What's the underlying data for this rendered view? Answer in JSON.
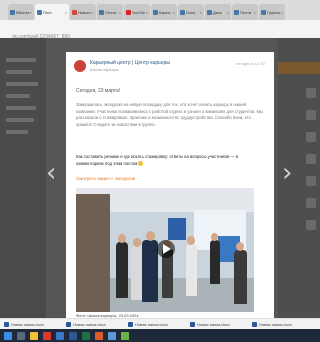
{
  "browser": {
    "tabs": [
      {
        "label": "ВКонтакте",
        "color": "#4a76a8",
        "active": false
      },
      {
        "label": "Пост",
        "color": "#4a76a8",
        "active": true
      },
      {
        "label": "Новости",
        "color": "#d64541",
        "active": false
      },
      {
        "label": "Почта",
        "color": "#4a76a8",
        "active": false
      },
      {
        "label": "YouTube",
        "color": "#e02020",
        "active": false
      },
      {
        "label": "Карты",
        "color": "#4a76a8",
        "active": false
      },
      {
        "label": "Docs",
        "color": "#4a76a8",
        "active": false
      },
      {
        "label": "Диск",
        "color": "#4a76a8",
        "active": false
      },
      {
        "label": "Почта",
        "color": "#4a76a8",
        "active": false
      },
      {
        "label": "Группа",
        "color": "#4a76a8",
        "active": false
      }
    ],
    "url": "vk.com/wall-1234567_890"
  },
  "post": {
    "author": "Карьерный центр | Центр карьеры",
    "subtitle": "Школа карьеры",
    "date": "сегодня в 12:30",
    "greeting": "Сегодня, 23 марта!",
    "paragraph": "Завершилась экскурсия на новую площадку для тех, кто хочет начать карьеру в нашей компании. Участники познакомились с работой отдела и узнали о вакансиях для студентов. Мы рассказали о стажировках, практике и возможностях трудоустройства. Спасибо всем, кто пришёл! Следите за новостями в группе.",
    "emphasis": "Как составить резюме и где искать стажировку: ответы на вопросы участников — в комментариях под этим постом",
    "orange_link": "Смотреть видео с экскурсии",
    "caption": "Фото: Школа карьеры, 23.03.2024"
  },
  "nav": {
    "prev": "‹",
    "next": "›"
  },
  "downloads": [
    {
      "label": "Новая папка.docx",
      "color": "#2b5797"
    },
    {
      "label": "Новая папка.docx",
      "color": "#2b5797"
    },
    {
      "label": "Новая папка.docx",
      "color": "#2b5797"
    },
    {
      "label": "Новая папка.docx",
      "color": "#2b5797"
    },
    {
      "label": "Новая папка.docx",
      "color": "#2b5797"
    }
  ],
  "taskbar": [
    {
      "name": "start-icon",
      "color": "#3a8ee6"
    },
    {
      "name": "search-icon",
      "color": "#5a6a7a"
    },
    {
      "name": "explorer-icon",
      "color": "#f2c230"
    },
    {
      "name": "browser-icon",
      "color": "#d93a2e"
    },
    {
      "name": "mail-icon",
      "color": "#3b78c6"
    },
    {
      "name": "word-icon",
      "color": "#2b5797"
    },
    {
      "name": "excel-icon",
      "color": "#1e7145"
    },
    {
      "name": "media-icon",
      "color": "#e05a2a"
    },
    {
      "name": "photos-icon",
      "color": "#5a9ad6"
    },
    {
      "name": "chat-icon",
      "color": "#6cb34a"
    }
  ],
  "colors": {
    "accent": "#2a5885",
    "highlight": "#e0781c"
  }
}
